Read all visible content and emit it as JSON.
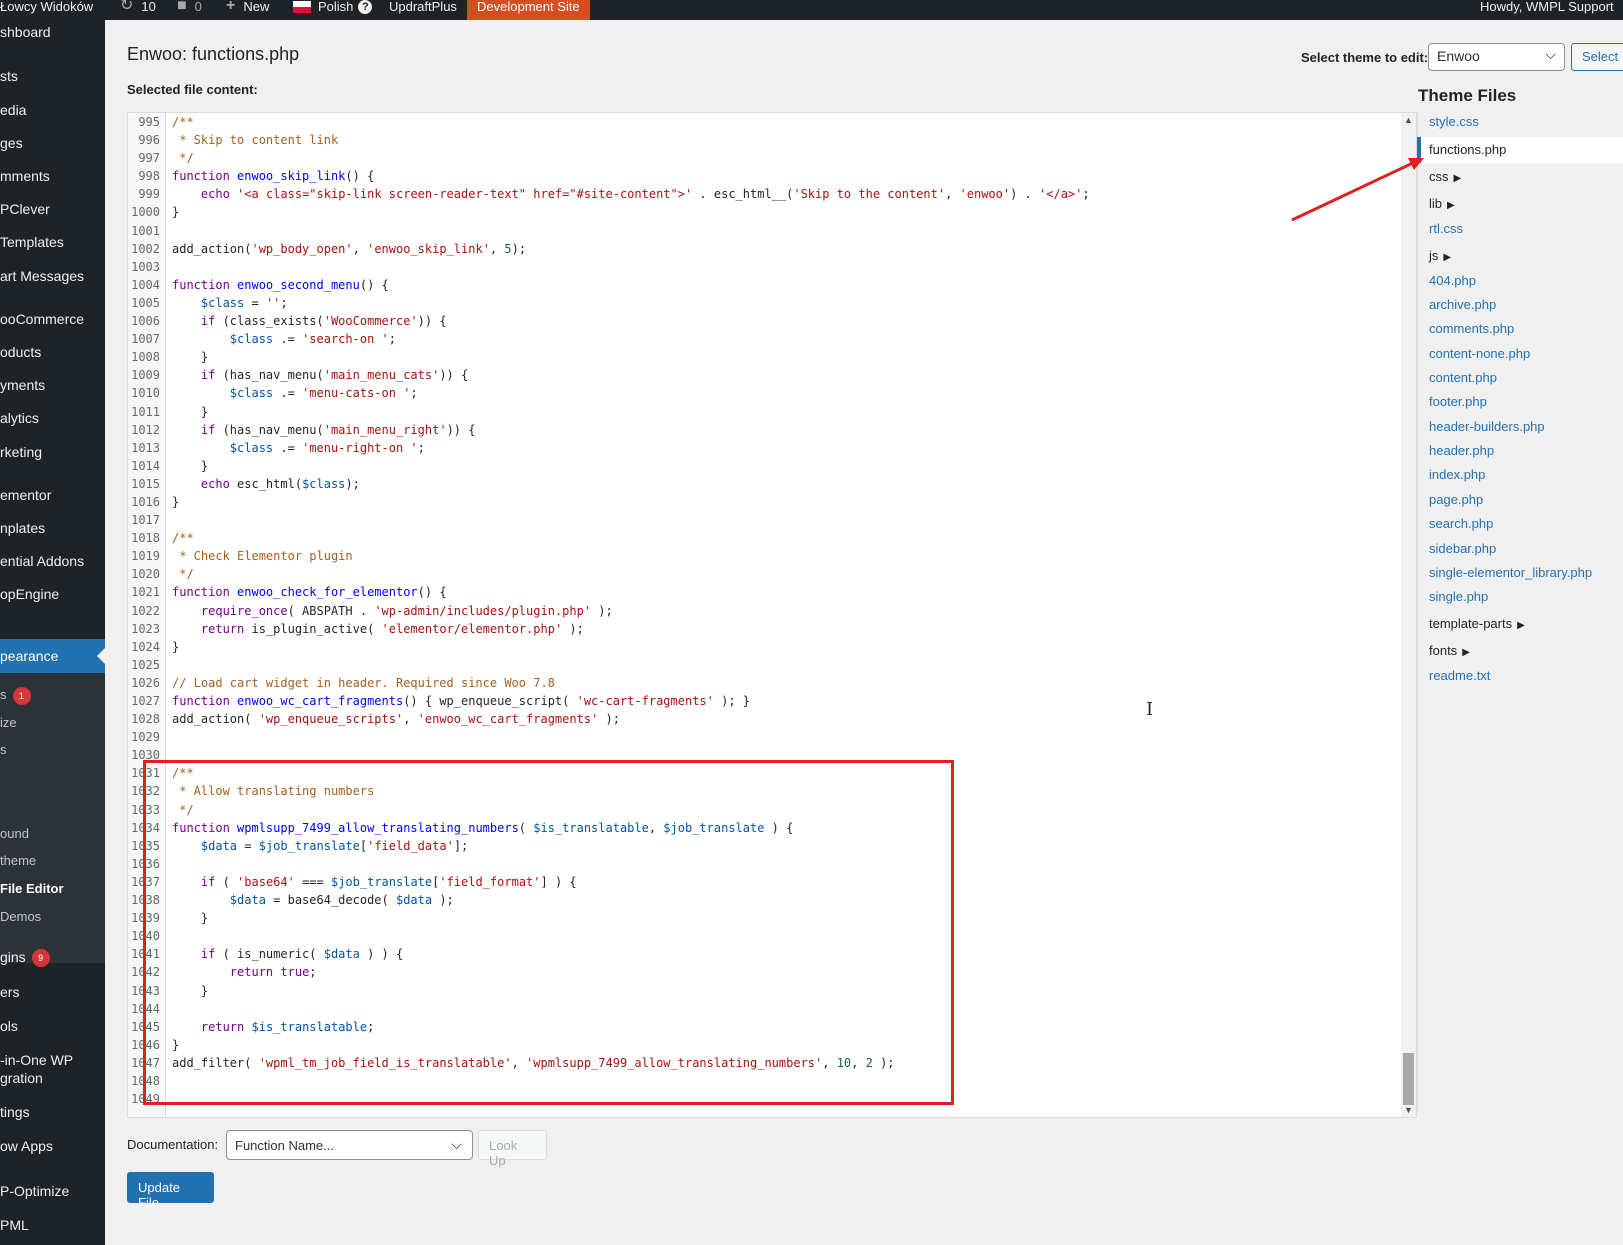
{
  "admin_bar": {
    "site_name": "Łowcy Widoków",
    "updates_count": "10",
    "comments_count": "0",
    "new_label": "New",
    "language_label": "Polish",
    "language_help": "?",
    "updraft_label": "UpdraftPlus",
    "dev_site_label": "Development Site",
    "howdy_label": "Howdy, WMPL Support"
  },
  "sidebar": {
    "items": [
      {
        "label": "shboard"
      },
      {
        "label": "sts"
      },
      {
        "label": "edia"
      },
      {
        "label": "ges"
      },
      {
        "label": "mments"
      },
      {
        "label": "PClever"
      },
      {
        "label": "Templates"
      },
      {
        "label": "art Messages"
      },
      {
        "label": "ooCommerce"
      },
      {
        "label": "oducts"
      },
      {
        "label": "yments"
      },
      {
        "label": "alytics"
      },
      {
        "label": "rketing"
      },
      {
        "label": "ementor"
      },
      {
        "label": "nplates"
      },
      {
        "label": "ential Addons"
      },
      {
        "label": "opEngine"
      },
      {
        "label": "pearance"
      },
      {
        "label": "s",
        "badge": "1"
      },
      {
        "label": "ize"
      },
      {
        "label": "s"
      },
      {
        "label": "ound"
      },
      {
        "label": "theme"
      },
      {
        "label": "File Editor"
      },
      {
        "label": "Demos"
      },
      {
        "label": "gins",
        "badge": "9"
      },
      {
        "label": "ers"
      },
      {
        "label": "ols"
      },
      {
        "label": "-in-One WP"
      },
      {
        "label": "gration"
      },
      {
        "label": "tings"
      },
      {
        "label": "ow Apps"
      },
      {
        "label": "P-Optimize"
      },
      {
        "label": "PML"
      }
    ]
  },
  "header": {
    "title": "Enwoo: functions.php",
    "select_theme_label": "Select theme to edit:",
    "theme_value": "Enwoo",
    "select_button": "Select",
    "selected_file_label": "Selected file content:"
  },
  "editor": {
    "lines": [
      {
        "n": "995",
        "code": "/**"
      },
      {
        "n": "996",
        "code": " * Skip to content link"
      },
      {
        "n": "997",
        "code": " */"
      },
      {
        "n": "998",
        "code": "function enwoo_skip_link() {"
      },
      {
        "n": "999",
        "code": "    echo '<a class=\"skip-link screen-reader-text\" href=\"#site-content\">' . esc_html__('Skip to the content', 'enwoo') . '</a>';"
      },
      {
        "n": "1000",
        "code": "}"
      },
      {
        "n": "1001",
        "code": ""
      },
      {
        "n": "1002",
        "code": "add_action('wp_body_open', 'enwoo_skip_link', 5);"
      },
      {
        "n": "1003",
        "code": ""
      },
      {
        "n": "1004",
        "code": "function enwoo_second_menu() {"
      },
      {
        "n": "1005",
        "code": "    $class = '';"
      },
      {
        "n": "1006",
        "code": "    if (class_exists('WooCommerce')) {"
      },
      {
        "n": "1007",
        "code": "        $class .= 'search-on ';"
      },
      {
        "n": "1008",
        "code": "    }"
      },
      {
        "n": "1009",
        "code": "    if (has_nav_menu('main_menu_cats')) {"
      },
      {
        "n": "1010",
        "code": "        $class .= 'menu-cats-on ';"
      },
      {
        "n": "1011",
        "code": "    }"
      },
      {
        "n": "1012",
        "code": "    if (has_nav_menu('main_menu_right')) {"
      },
      {
        "n": "1013",
        "code": "        $class .= 'menu-right-on ';"
      },
      {
        "n": "1014",
        "code": "    }"
      },
      {
        "n": "1015",
        "code": "    echo esc_html($class);"
      },
      {
        "n": "1016",
        "code": "}"
      },
      {
        "n": "1017",
        "code": ""
      },
      {
        "n": "1018",
        "code": "/**"
      },
      {
        "n": "1019",
        "code": " * Check Elementor plugin"
      },
      {
        "n": "1020",
        "code": " */"
      },
      {
        "n": "1021",
        "code": "function enwoo_check_for_elementor() {"
      },
      {
        "n": "1022",
        "code": "    require_once( ABSPATH . 'wp-admin/includes/plugin.php' );"
      },
      {
        "n": "1023",
        "code": "    return is_plugin_active( 'elementor/elementor.php' );"
      },
      {
        "n": "1024",
        "code": "}"
      },
      {
        "n": "1025",
        "code": ""
      },
      {
        "n": "1026",
        "code": "// Load cart widget in header. Required since Woo 7.8"
      },
      {
        "n": "1027",
        "code": "function enwoo_wc_cart_fragments() { wp_enqueue_script( 'wc-cart-fragments' ); }"
      },
      {
        "n": "1028",
        "code": "add_action( 'wp_enqueue_scripts', 'enwoo_wc_cart_fragments' );"
      },
      {
        "n": "1029",
        "code": ""
      },
      {
        "n": "1030",
        "code": ""
      },
      {
        "n": "1031",
        "code": "/**"
      },
      {
        "n": "1032",
        "code": " * Allow translating numbers"
      },
      {
        "n": "1033",
        "code": " */"
      },
      {
        "n": "1034",
        "code": "function wpmlsupp_7499_allow_translating_numbers( $is_translatable, $job_translate ) {"
      },
      {
        "n": "1035",
        "code": "    $data = $job_translate['field_data'];"
      },
      {
        "n": "1036",
        "code": ""
      },
      {
        "n": "1037",
        "code": "    if ( 'base64' === $job_translate['field_format'] ) {"
      },
      {
        "n": "1038",
        "code": "        $data = base64_decode( $data );"
      },
      {
        "n": "1039",
        "code": "    }"
      },
      {
        "n": "1040",
        "code": ""
      },
      {
        "n": "1041",
        "code": "    if ( is_numeric( $data ) ) {"
      },
      {
        "n": "1042",
        "code": "        return true;"
      },
      {
        "n": "1043",
        "code": "    }"
      },
      {
        "n": "1044",
        "code": ""
      },
      {
        "n": "1045",
        "code": "    return $is_translatable;"
      },
      {
        "n": "1046",
        "code": "}"
      },
      {
        "n": "1047",
        "code": "add_filter( 'wpml_tm_job_field_is_translatable', 'wpmlsupp_7499_allow_translating_numbers', 10, 2 );"
      },
      {
        "n": "1048",
        "code": ""
      },
      {
        "n": "1049",
        "code": ""
      }
    ]
  },
  "theme_files": {
    "title": "Theme Files",
    "items": [
      {
        "label": "style.css",
        "type": "file"
      },
      {
        "label": "functions.php",
        "type": "current"
      },
      {
        "label": "css",
        "type": "folder"
      },
      {
        "label": "lib",
        "type": "folder"
      },
      {
        "label": "rtl.css",
        "type": "file"
      },
      {
        "label": "js",
        "type": "folder"
      },
      {
        "label": "404.php",
        "type": "file"
      },
      {
        "label": "archive.php",
        "type": "file"
      },
      {
        "label": "comments.php",
        "type": "file"
      },
      {
        "label": "content-none.php",
        "type": "file"
      },
      {
        "label": "content.php",
        "type": "file"
      },
      {
        "label": "footer.php",
        "type": "file"
      },
      {
        "label": "header-builders.php",
        "type": "file"
      },
      {
        "label": "header.php",
        "type": "file"
      },
      {
        "label": "index.php",
        "type": "file"
      },
      {
        "label": "page.php",
        "type": "file"
      },
      {
        "label": "search.php",
        "type": "file"
      },
      {
        "label": "sidebar.php",
        "type": "file"
      },
      {
        "label": "single-elementor_library.php",
        "type": "file"
      },
      {
        "label": "single.php",
        "type": "file"
      },
      {
        "label": "template-parts",
        "type": "folder"
      },
      {
        "label": "fonts",
        "type": "folder"
      },
      {
        "label": "readme.txt",
        "type": "file"
      }
    ]
  },
  "footer": {
    "documentation_label": "Documentation:",
    "function_placeholder": "Function Name...",
    "lookup_button": "Look Up",
    "update_button": "Update File"
  },
  "colors": {
    "admin_dark": "#1d2327",
    "accent_blue": "#2271b1",
    "dev_site_orange": "#d54e21",
    "annotation_red": "#e02020",
    "badge_red": "#d63638"
  },
  "icons": {
    "updates": "refresh-icon",
    "comments": "comment-icon",
    "new": "plus-icon",
    "language": "poland-flag-icon"
  }
}
